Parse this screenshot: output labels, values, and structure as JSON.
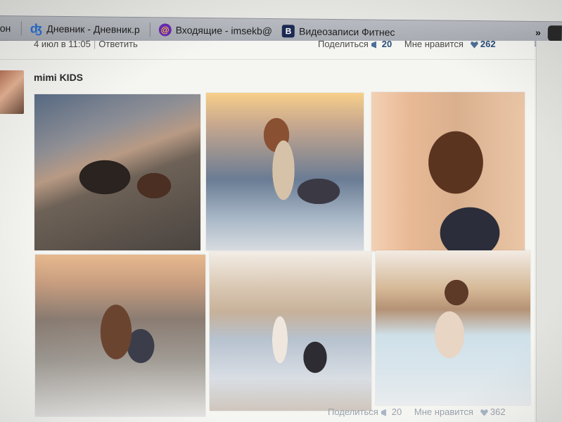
{
  "bookmarks": [
    {
      "label": "он",
      "icon": ""
    },
    {
      "label": "Дневник - Дневник.р",
      "icon": "diary-icon"
    },
    {
      "label": "Входящие - imsekb@",
      "icon": "mail-icon"
    },
    {
      "label": "Видеозаписи Фитнес",
      "icon": "vk-icon"
    }
  ],
  "bookmarks_overflow": "»",
  "post_top": {
    "date": "4 июл в 11:05",
    "reply": "Ответить",
    "share_label": "Поделиться",
    "share_count": "20",
    "like_label": "Мне нравится",
    "like_count": "262"
  },
  "post": {
    "author": "mimi KIDS",
    "photos": [
      "photo-1",
      "photo-2",
      "photo-3",
      "photo-4",
      "photo-5",
      "photo-6"
    ],
    "share_label": "Поделиться",
    "share_count": "20",
    "like_label": "Мне нравится",
    "like_count": "362"
  },
  "colors": {
    "bookmarks_bar": "#b1b4ba",
    "page_background": "#f5f5f2",
    "count_accent": "#2a4d77"
  }
}
